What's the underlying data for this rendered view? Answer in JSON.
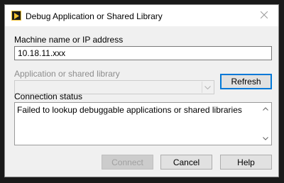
{
  "window": {
    "title": "Debug Application or Shared Library",
    "icon": "labview-app-icon",
    "close_icon": "close-icon"
  },
  "machine": {
    "label": "Machine name or IP address",
    "value": "10.18.11.xxx"
  },
  "application": {
    "label": "Application or shared library",
    "selected": "",
    "enabled": false
  },
  "refresh_label": "Refresh",
  "status": {
    "label": "Connection status",
    "text": "Failed to lookup debuggable applications or shared libraries"
  },
  "buttons": {
    "connect": "Connect",
    "connect_enabled": false,
    "cancel": "Cancel",
    "help": "Help"
  },
  "colors": {
    "accent": "#0078d7",
    "icon_border": "#f2c230",
    "disabled_text": "#8d8d8d"
  }
}
